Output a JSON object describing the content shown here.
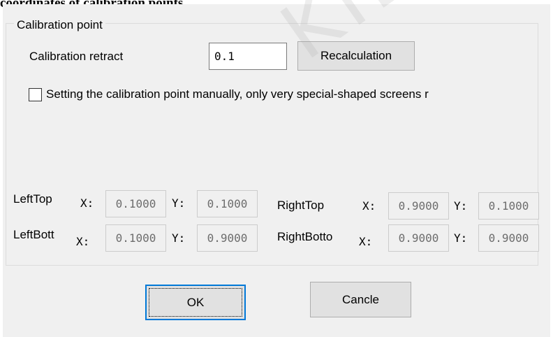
{
  "truncated_heading": "coordinates of calibration points.",
  "group": {
    "title": "Calibration point"
  },
  "retract": {
    "label": "Calibration retract",
    "value": "0.1"
  },
  "recalc_button": "Recalculation",
  "manual_checkbox": {
    "label": "Setting the calibration point manually, only very special-shaped screens r",
    "checked": false
  },
  "points": {
    "left_top": {
      "label": "LeftTop",
      "x_label": "X:",
      "y_label": "Y:",
      "x": "0.1000",
      "y": "0.1000"
    },
    "right_top": {
      "label": "RightTop",
      "x_label": "X:",
      "y_label": "Y:",
      "x": "0.9000",
      "y": "0.1000"
    },
    "left_bottom": {
      "label": "LeftBott",
      "x_label": "X:",
      "y_label": "Y:",
      "x": "0.1000",
      "y": "0.9000"
    },
    "right_bottom": {
      "label": "RightBotto",
      "x_label": "X:",
      "y_label": "Y:",
      "x": "0.9000",
      "y": "0.9000"
    }
  },
  "buttons": {
    "ok": "OK",
    "cancel": "Cancle"
  },
  "watermark": "KIEA"
}
